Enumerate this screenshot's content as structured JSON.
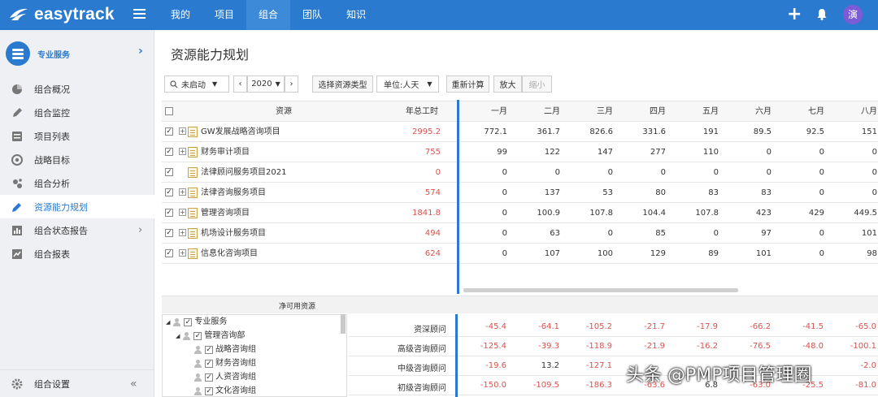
{
  "app": {
    "logo": "easytrack",
    "avatar": "演"
  },
  "nav": [
    {
      "label": "我的"
    },
    {
      "label": "项目"
    },
    {
      "label": "组合"
    },
    {
      "label": "团队"
    },
    {
      "label": "知识"
    }
  ],
  "sidebar": {
    "title": "专业服务",
    "items": [
      {
        "label": "组合概况",
        "icon": "pie-icon"
      },
      {
        "label": "组合监控",
        "icon": "pen-icon"
      },
      {
        "label": "项目列表",
        "icon": "list-icon"
      },
      {
        "label": "战略目标",
        "icon": "target-icon"
      },
      {
        "label": "组合分析",
        "icon": "analysis-icon"
      },
      {
        "label": "资源能力规划",
        "icon": "pencil-icon"
      },
      {
        "label": "组合状态报告",
        "icon": "bar-chart-icon"
      },
      {
        "label": "组合报表",
        "icon": "line-chart-icon"
      }
    ],
    "footer": "组合设置"
  },
  "page": {
    "title": "资源能力规划"
  },
  "toolbar": {
    "status": "未启动",
    "year": "2020",
    "select_type": "选择资源类型",
    "unit": "单位:人天",
    "recalc": "重新计算",
    "zoom_in": "放大",
    "zoom_out": "缩小"
  },
  "table": {
    "headers": {
      "resource": "资源",
      "annual": "年总工时"
    },
    "months": [
      "一月",
      "二月",
      "三月",
      "四月",
      "五月",
      "六月",
      "七月",
      "八月"
    ],
    "rows": [
      {
        "name": "GW发展战略咨询项目",
        "total": "2995.2",
        "v": [
          "772.1",
          "361.7",
          "826.6",
          "331.6",
          "191",
          "89.5",
          "92.5",
          "151"
        ]
      },
      {
        "name": "财务审计项目",
        "total": "755",
        "v": [
          "99",
          "122",
          "147",
          "277",
          "110",
          "0",
          "0",
          "0"
        ]
      },
      {
        "name": "法律顾问服务项目2021",
        "total": "0",
        "v": [
          "0",
          "0",
          "0",
          "0",
          "0",
          "0",
          "0",
          "0"
        ]
      },
      {
        "name": "法律咨询服务项目",
        "total": "574",
        "v": [
          "0",
          "137",
          "53",
          "80",
          "83",
          "83",
          "0",
          "0"
        ]
      },
      {
        "name": "管理咨询项目",
        "total": "1841.8",
        "v": [
          "0",
          "100.9",
          "107.8",
          "104.4",
          "107.8",
          "423",
          "429",
          "449.5"
        ]
      },
      {
        "name": "机场设计服务项目",
        "total": "494",
        "v": [
          "0",
          "63",
          "0",
          "85",
          "0",
          "97",
          "0",
          "101"
        ]
      },
      {
        "name": "信息化咨询项目",
        "total": "624",
        "v": [
          "0",
          "107",
          "100",
          "129",
          "89",
          "101",
          "0",
          "98"
        ]
      }
    ]
  },
  "net": {
    "title": "净可用资源",
    "tree": [
      "专业服务",
      "管理咨询部",
      "战略咨询组",
      "财务咨询组",
      "人资咨询组",
      "文化咨询组"
    ],
    "rows": [
      {
        "label": "资深顾问",
        "v": [
          "-45.4",
          "-64.1",
          "-105.2",
          "-21.7",
          "-17.9",
          "-66.2",
          "-41.5",
          "-65.0"
        ]
      },
      {
        "label": "高级咨询顾问",
        "v": [
          "-125.4",
          "-39.3",
          "-118.9",
          "-21.9",
          "-16.2",
          "-76.5",
          "-48.0",
          "-100.1"
        ]
      },
      {
        "label": "中级咨询顾问",
        "v": [
          "-19.6",
          "13.2",
          "-127.1",
          "",
          "",
          "",
          "",
          "-2.0"
        ]
      },
      {
        "label": "初级咨询顾问",
        "v": [
          "-150.0",
          "-109.5",
          "-186.3",
          "-63.6",
          "6.8",
          "-63.0",
          "-25.5",
          "-81.0"
        ]
      }
    ]
  },
  "watermark": "头条 @PMP项目管理圈"
}
